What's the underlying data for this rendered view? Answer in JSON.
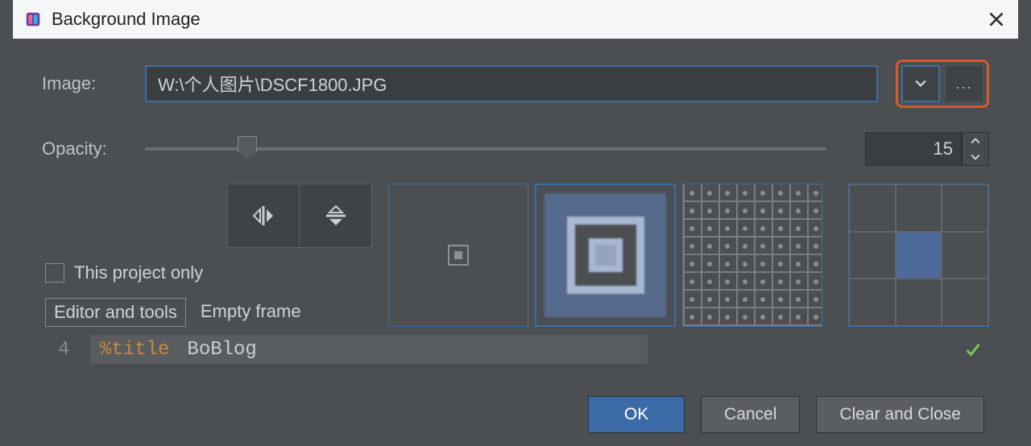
{
  "dialog": {
    "title": "Background Image"
  },
  "image": {
    "label": "Image:",
    "path": "W:\\个人图片\\DSCF1800.JPG",
    "browse_label": "..."
  },
  "opacity": {
    "label": "Opacity:",
    "value": "15",
    "percent": 15
  },
  "options": {
    "this_project_only": "This project only",
    "scope_editor": "Editor and tools",
    "scope_empty": "Empty frame"
  },
  "code": {
    "line_no": "4",
    "directive": "%title",
    "value": "BoBlog"
  },
  "buttons": {
    "ok": "OK",
    "cancel": "Cancel",
    "clear": "Clear and Close"
  }
}
